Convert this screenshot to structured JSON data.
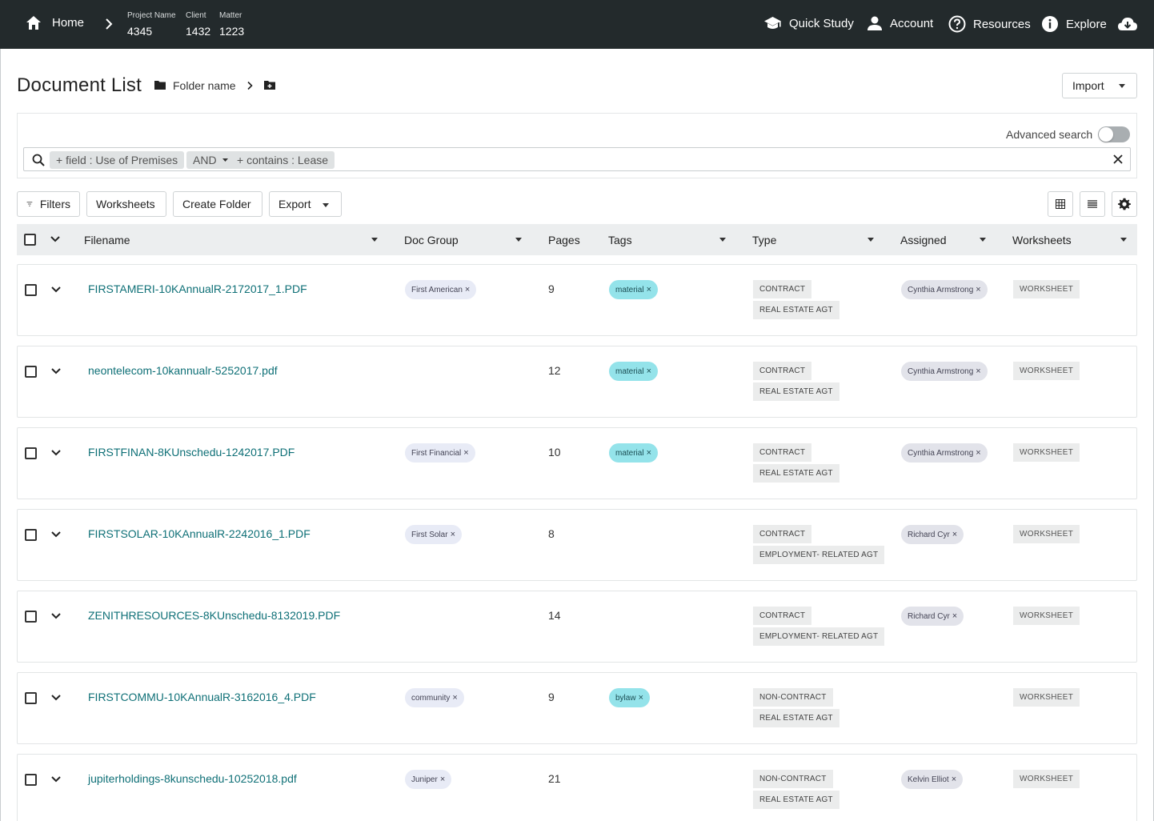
{
  "nav": {
    "home_label": "Home",
    "project_label": "Project Name",
    "project_value": "4345",
    "client_label": "Client",
    "client_value": "1432",
    "matter_label": "Matter",
    "matter_value": "1223",
    "quick_study": "Quick Study",
    "account": "Account",
    "resources": "Resources",
    "explore": "Explore"
  },
  "page": {
    "title": "Document List",
    "folder_name": "Folder name",
    "import_label": "Import"
  },
  "search": {
    "advanced_label": "Advanced search",
    "advanced_enabled": false,
    "chips": [
      "+ field : Use of Premises",
      "AND",
      "+ contains : Lease"
    ]
  },
  "toolbar": {
    "filters": "Filters",
    "worksheets": "Worksheets",
    "create_folder": "Create Folder",
    "export": "Export"
  },
  "columns": {
    "filename": "Filename",
    "doc_group": "Doc Group",
    "pages": "Pages",
    "tags": "Tags",
    "type": "Type",
    "assigned": "Assigned",
    "worksheets": "Worksheets"
  },
  "rows": [
    {
      "filename": "FIRSTAMERI-10KAnnualR-2172017_1.PDF",
      "doc_group": "First American",
      "pages": "9",
      "tag": "material",
      "type1": "CONTRACT",
      "type2": "REAL ESTATE AGT",
      "assigned": "Cynthia Armstrong",
      "worksheet": "WORKSHEET"
    },
    {
      "filename": "neontelecom-10kannualr-5252017.pdf",
      "doc_group": "",
      "pages": "12",
      "tag": "material",
      "type1": "CONTRACT",
      "type2": "REAL ESTATE AGT",
      "assigned": "Cynthia Armstrong",
      "worksheet": "WORKSHEET"
    },
    {
      "filename": "FIRSTFINAN-8KUnschedu-1242017.PDF",
      "doc_group": "First Financial",
      "pages": "10",
      "tag": "material",
      "type1": "CONTRACT",
      "type2": "REAL ESTATE AGT",
      "assigned": "Cynthia Armstrong",
      "worksheet": "WORKSHEET"
    },
    {
      "filename": "FIRSTSOLAR-10KAnnualR-2242016_1.PDF",
      "doc_group": "First Solar",
      "pages": "8",
      "tag": "",
      "type1": "CONTRACT",
      "type2": "EMPLOYMENT- RELATED AGT",
      "assigned": "Richard Cyr",
      "worksheet": "WORKSHEET"
    },
    {
      "filename": "ZENITHRESOURCES-8KUnschedu-8132019.PDF",
      "doc_group": "",
      "pages": "14",
      "tag": "",
      "type1": "CONTRACT",
      "type2": "EMPLOYMENT- RELATED AGT",
      "assigned": "Richard Cyr",
      "worksheet": "WORKSHEET"
    },
    {
      "filename": "FIRSTCOMMU-10KAnnualR-3162016_4.PDF",
      "doc_group": "community",
      "pages": "9",
      "tag": "bylaw",
      "type1": "NON-CONTRACT",
      "type2": "REAL ESTATE AGT",
      "assigned": "",
      "worksheet": "WORKSHEET"
    },
    {
      "filename": "jupiterholdings-8kunschedu-10252018.pdf",
      "doc_group": "Juniper",
      "pages": "21",
      "tag": "",
      "type1": "NON-CONTRACT",
      "type2": "REAL ESTATE AGT",
      "assigned": "Kelvin Elliot",
      "worksheet": "WORKSHEET"
    }
  ],
  "colors": {
    "topbar": "#232a2c",
    "link": "#0f7077",
    "tag_pill": "#94e3ea",
    "group_pill": "#e8ebf6",
    "assigned_pill": "#e2e3ea"
  },
  "icons": {
    "home": "home-icon",
    "quick_study": "graduation-cap-icon",
    "account": "person-icon",
    "resources": "help-circle-icon",
    "explore": "info-circle-icon",
    "download": "cloud-download-icon",
    "folder": "folder-icon",
    "new_folder": "folder-plus-icon",
    "search": "search-icon",
    "filter": "filter-icon",
    "grid_view": "grid-view-icon",
    "list_view": "list-view-icon",
    "settings": "gear-icon"
  }
}
